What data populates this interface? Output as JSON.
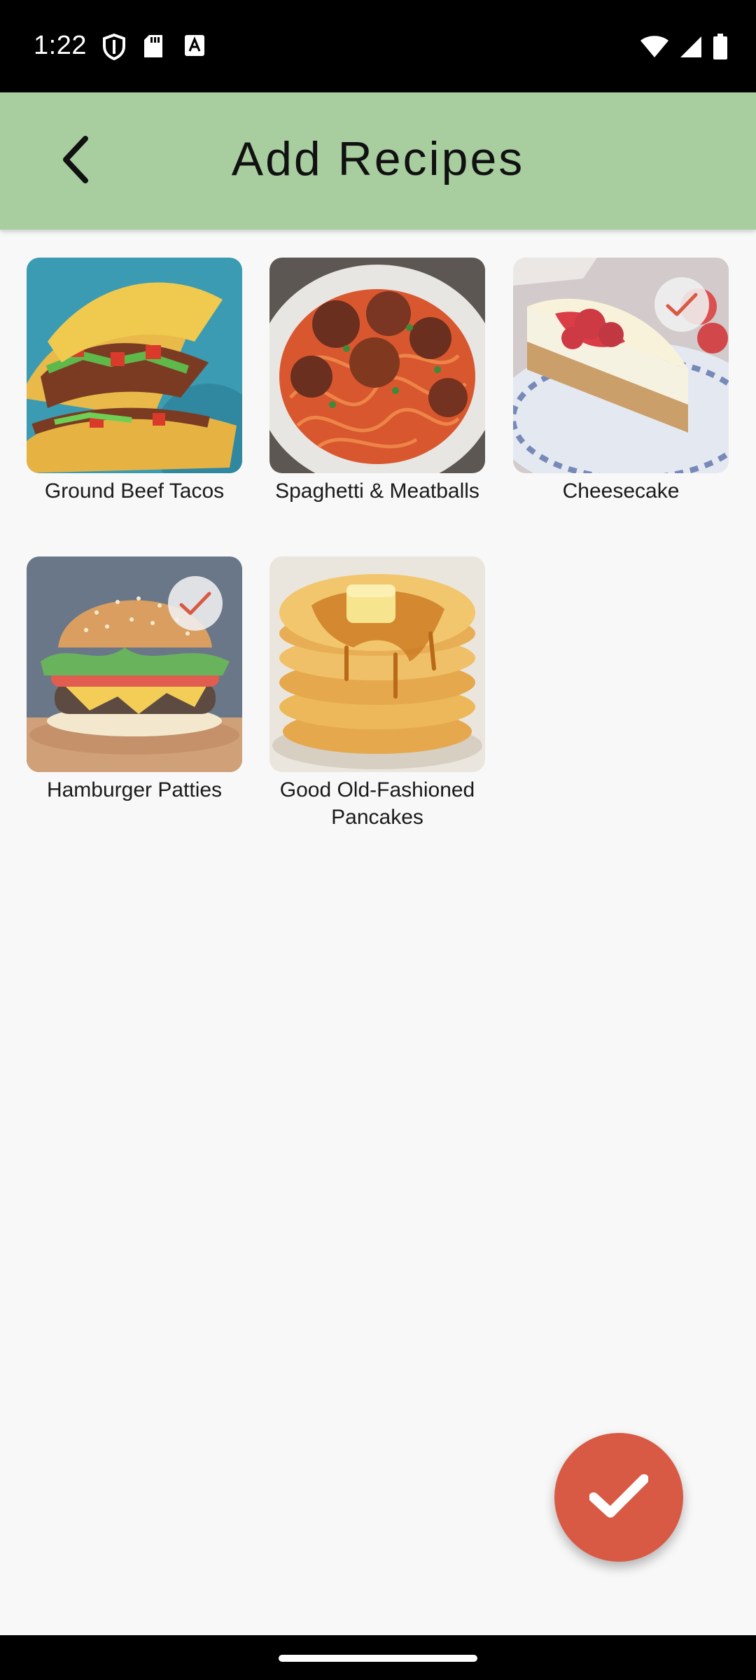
{
  "status_bar": {
    "time": "1:22",
    "icons_left": [
      "shield-icon",
      "sd-card-icon",
      "text-box-icon"
    ],
    "icons_right": [
      "wifi-icon",
      "signal-icon",
      "battery-icon"
    ]
  },
  "header": {
    "title": "Add Recipes",
    "back_icon": "chevron-left-icon",
    "background": "#a8cd9f"
  },
  "recipes": [
    {
      "label": "Ground Beef Tacos",
      "selected": false
    },
    {
      "label": "Spaghetti & Meatballs",
      "selected": false
    },
    {
      "label": "Cheesecake",
      "selected": true
    },
    {
      "label": "Hamburger Patties",
      "selected": true
    },
    {
      "label": "Good Old-Fashioned Pancakes",
      "selected": false
    }
  ],
  "fab": {
    "icon": "checkmark-icon",
    "color": "#d95a44"
  },
  "colors": {
    "accent": "#d95a44",
    "check_mark": "#d95a44",
    "app_bar": "#a8cd9f"
  }
}
